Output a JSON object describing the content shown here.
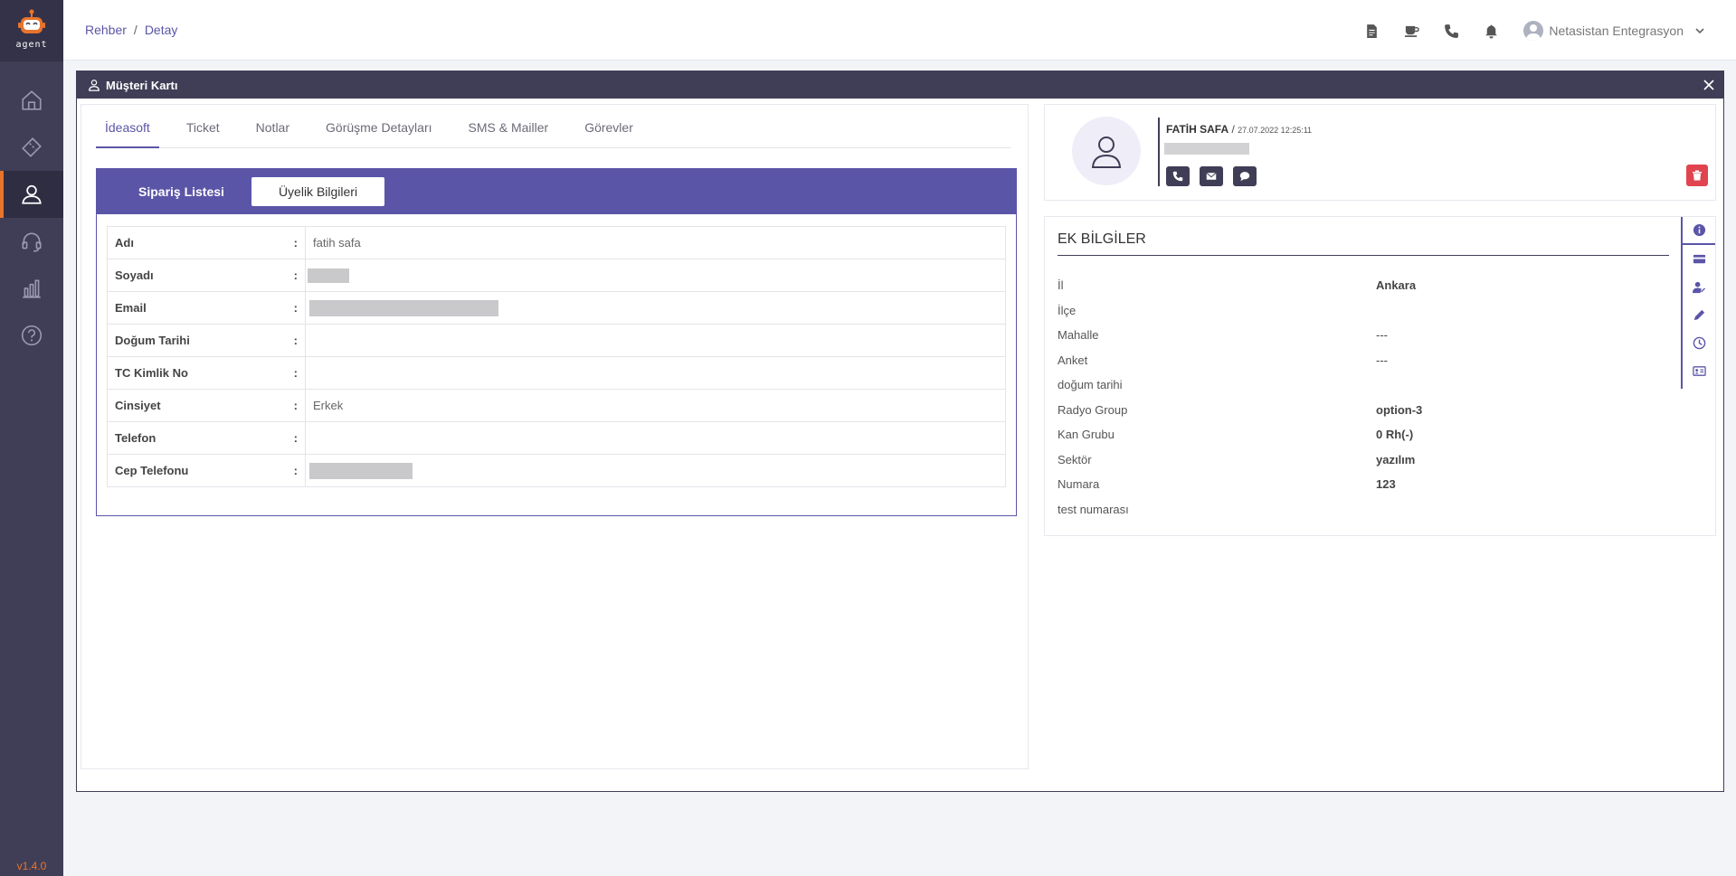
{
  "app": {
    "logo_text": "agent",
    "version": "v1.4.0"
  },
  "colors": {
    "sidebar": "#403e56",
    "accent": "#5b55a8",
    "orange": "#e8742c",
    "danger": "#e0454f"
  },
  "sidebar": {
    "items": [
      {
        "icon": "home-icon"
      },
      {
        "icon": "ticket-icon"
      },
      {
        "icon": "user-icon",
        "active": true
      },
      {
        "icon": "headset-icon"
      },
      {
        "icon": "chart-icon"
      },
      {
        "icon": "help-icon"
      }
    ]
  },
  "header": {
    "breadcrumb": [
      "Rehber",
      "Detay"
    ],
    "user_name": "Netasistan Entegrasyon"
  },
  "modal": {
    "title": "Müşteri Kartı"
  },
  "tabs": [
    "İdeasoft",
    "Ticket",
    "Notlar",
    "Görüşme Detayları",
    "SMS & Mailler",
    "Görevler"
  ],
  "subtabs": [
    "Sipariş Listesi",
    "Üyelik Bilgileri"
  ],
  "member_info": [
    {
      "label": "Adı",
      "value": "fatih safa"
    },
    {
      "label": "Soyadı",
      "value": ""
    },
    {
      "label": "Email",
      "value": ""
    },
    {
      "label": "Doğum Tarihi",
      "value": ""
    },
    {
      "label": "TC Kimlik No",
      "value": ""
    },
    {
      "label": "Cinsiyet",
      "value": "Erkek"
    },
    {
      "label": "Telefon",
      "value": ""
    },
    {
      "label": "Cep Telefonu",
      "value": ""
    }
  ],
  "contact": {
    "name": "FATİH SAFA",
    "date": "27.07.2022 12:25:11"
  },
  "extra_info": {
    "title": "EK BİLGİLER",
    "rows": [
      {
        "label": "İl",
        "value": "Ankara"
      },
      {
        "label": "İlçe",
        "value": ""
      },
      {
        "label": "Mahalle",
        "value": "---"
      },
      {
        "label": "Anket",
        "value": "---"
      },
      {
        "label": "doğum tarihi",
        "value": ""
      },
      {
        "label": "Radyo Group",
        "value": "option-3"
      },
      {
        "label": "Kan Grubu",
        "value": "0 Rh(-)"
      },
      {
        "label": "Sektör",
        "value": "yazılım"
      },
      {
        "label": "Numara",
        "value": "123"
      },
      {
        "label": "test numarası",
        "value": ""
      }
    ]
  }
}
